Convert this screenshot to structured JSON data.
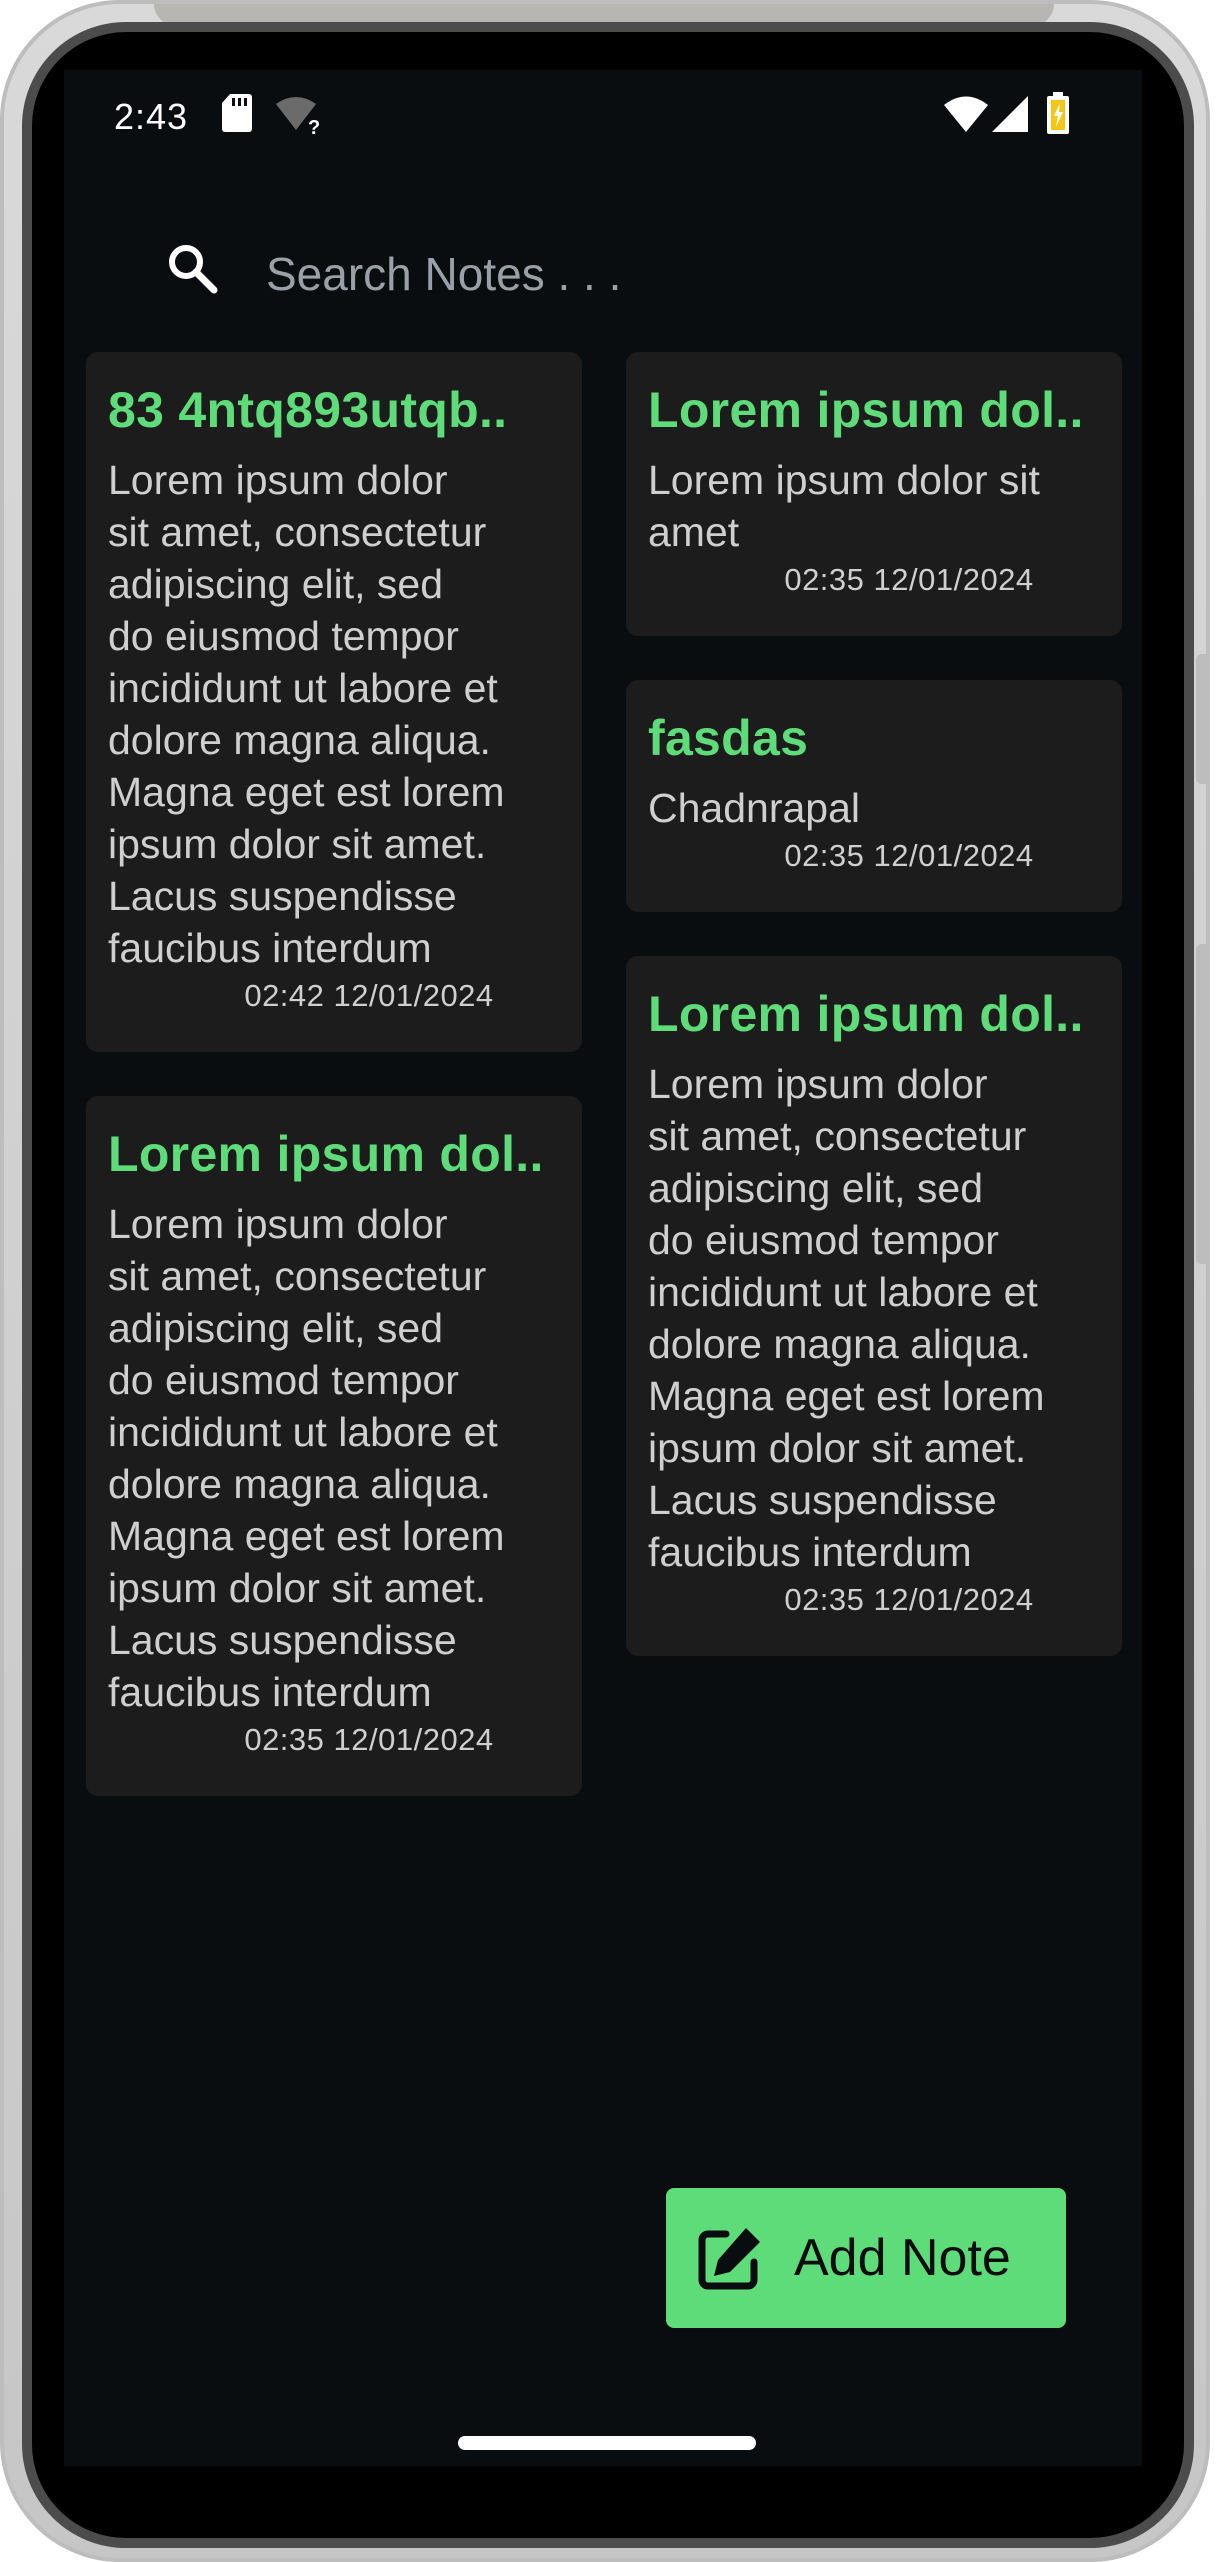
{
  "status_bar": {
    "time": "2:43",
    "icons": [
      "sd-card-icon",
      "wifi-unknown-icon",
      "wifi-icon",
      "signal-icon",
      "battery-charging-icon"
    ]
  },
  "search": {
    "placeholder": "Search Notes . . ."
  },
  "notes": [
    {
      "title": "83 4ntq893utqb..",
      "body": "Lorem ipsum dolor\nsit amet, consectetur\nadipiscing elit, sed\ndo eiusmod tempor\nincididunt ut labore et\ndolore magna aliqua.\nMagna eget est lorem\nipsum dolor sit amet.\nLacus suspendisse\nfaucibus interdum",
      "timestamp": "02:42 12/01/2024"
    },
    {
      "title": "Lorem ipsum dol..",
      "body": "Lorem ipsum dolor sit\namet",
      "timestamp": "02:35 12/01/2024"
    },
    {
      "title": "fasdas",
      "body": "Chadnrapal",
      "timestamp": "02:35 12/01/2024"
    },
    {
      "title": "Lorem ipsum dol..",
      "body": "Lorem ipsum dolor\nsit amet, consectetur\nadipiscing elit, sed\ndo eiusmod tempor\nincididunt ut labore et\ndolore magna aliqua.\nMagna eget est lorem\nipsum dolor sit amet.\nLacus suspendisse\nfaucibus interdum",
      "timestamp": "02:35 12/01/2024"
    },
    {
      "title": "Lorem ipsum dol..",
      "body": "Lorem ipsum dolor\nsit amet, consectetur\nadipiscing elit, sed\ndo eiusmod tempor\nincididunt ut labore et\ndolore magna aliqua.\nMagna eget est lorem\nipsum dolor sit amet.\nLacus suspendisse\nfaucibus interdum",
      "timestamp": "02:35 12/01/2024"
    }
  ],
  "fab": {
    "label": "Add Note",
    "icon": "edit-note-icon"
  },
  "colors": {
    "background": "#0a0d10",
    "card": "#1c1c1c",
    "accent": "#5fdc7a",
    "text": "#cfcfcf"
  }
}
